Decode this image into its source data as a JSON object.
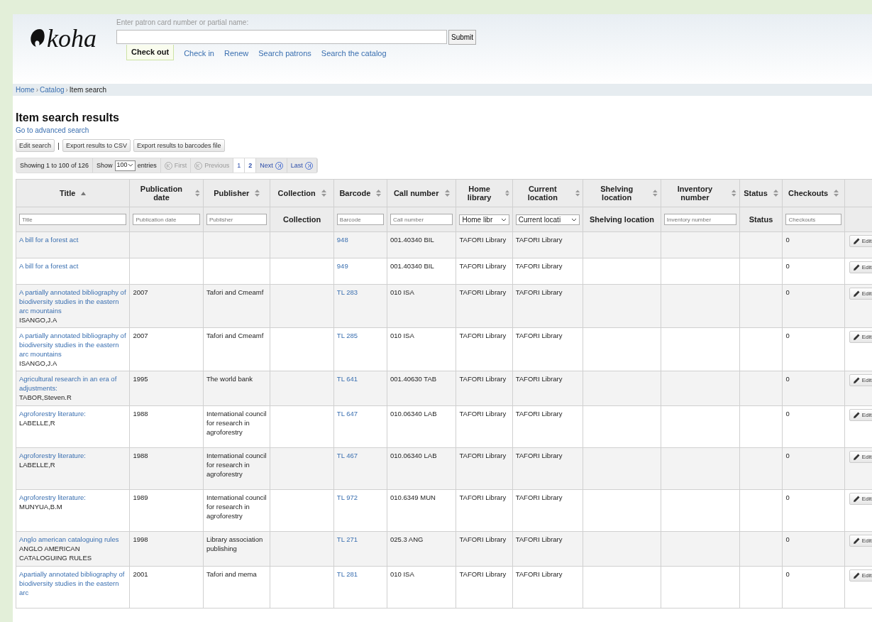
{
  "header": {
    "logo": "koha",
    "search_label": "Enter patron card number or partial name:",
    "submit": "Submit",
    "tabs": [
      {
        "label": "Check out",
        "selected": true
      },
      {
        "label": "Check in",
        "selected": false
      },
      {
        "label": "Renew",
        "selected": false
      },
      {
        "label": "Search patrons",
        "selected": false
      },
      {
        "label": "Search the catalog",
        "selected": false
      }
    ]
  },
  "breadcrumbs": [
    {
      "label": "Home",
      "link": true
    },
    {
      "label": "Catalog",
      "link": true
    },
    {
      "label": "Item search",
      "link": false
    }
  ],
  "breadcrumb_separator": "›",
  "page_title": "Item search results",
  "advanced_link": "Go to advanced search",
  "toolbar": {
    "buttons": [
      "Edit search",
      "Export results to CSV",
      "Export results to barcodes file"
    ],
    "separator": "|"
  },
  "pagination": {
    "info": "Showing 1 to 100 of 126",
    "show_label": "Show",
    "page_size": "100",
    "entries_label": "entries",
    "controls": [
      {
        "kind": "nav",
        "label": "First",
        "disabled": true
      },
      {
        "kind": "nav",
        "label": "Previous",
        "disabled": true
      },
      {
        "kind": "page",
        "label": "1",
        "selected": true
      },
      {
        "kind": "page",
        "label": "2",
        "selected": false
      },
      {
        "kind": "nav",
        "label": "Next",
        "disabled": false
      },
      {
        "kind": "nav",
        "label": "Last",
        "disabled": false
      }
    ]
  },
  "table": {
    "columns": [
      {
        "label": "Title",
        "sorted": true,
        "filter": {
          "kind": "input",
          "placeholder": "Title"
        }
      },
      {
        "label": "Publication date",
        "sorted": false,
        "filter": {
          "kind": "input",
          "placeholder": "Publication date"
        }
      },
      {
        "label": "Publisher",
        "sorted": false,
        "filter": {
          "kind": "input",
          "placeholder": "Publisher"
        }
      },
      {
        "label": "Collection",
        "sorted": false,
        "filter": {
          "kind": "label",
          "text": "Collection"
        }
      },
      {
        "label": "Barcode",
        "sorted": false,
        "filter": {
          "kind": "input",
          "placeholder": "Barcode"
        }
      },
      {
        "label": "Call number",
        "sorted": false,
        "filter": {
          "kind": "input",
          "placeholder": "Call number"
        }
      },
      {
        "label": "Home library",
        "sorted": false,
        "filter": {
          "kind": "select",
          "value": "Home libr"
        }
      },
      {
        "label": "Current location",
        "sorted": false,
        "filter": {
          "kind": "select",
          "value": "Current locati"
        }
      },
      {
        "label": "Shelving location",
        "sorted": false,
        "filter": {
          "kind": "label",
          "text": "Shelving location"
        }
      },
      {
        "label": "Inventory number",
        "sorted": false,
        "filter": {
          "kind": "input",
          "placeholder": "Inventory number"
        }
      },
      {
        "label": "Status",
        "sorted": false,
        "filter": {
          "kind": "label",
          "text": "Status"
        }
      },
      {
        "label": "Checkouts",
        "sorted": false,
        "filter": {
          "kind": "input",
          "placeholder": "Checkouts"
        }
      }
    ],
    "rows": [
      {
        "title": "A bill for a forest act",
        "author": "",
        "date": "",
        "publisher": "",
        "collection": "",
        "barcode": "948",
        "call_number": "001.40340 BIL",
        "home": "TAFORI Library",
        "current": "TAFORI Library",
        "shelving": "",
        "inventory": "",
        "status": "",
        "checkouts": "0",
        "action": "Edit"
      },
      {
        "title": "A bill for a forest act",
        "author": "",
        "date": "",
        "publisher": "",
        "collection": "",
        "barcode": "949",
        "call_number": "001.40340 BIL",
        "home": "TAFORI Library",
        "current": "TAFORI Library",
        "shelving": "",
        "inventory": "",
        "status": "",
        "checkouts": "0",
        "action": "Edit"
      },
      {
        "title": "A partially annotated bibliography of biodiversity studies in the eastern arc mountains",
        "author": "ISANGO,J.A",
        "date": "2007",
        "publisher": "Tafori and Cmeamf",
        "collection": "",
        "barcode": "TL 283",
        "call_number": "010 ISA",
        "home": "TAFORI Library",
        "current": "TAFORI Library",
        "shelving": "",
        "inventory": "",
        "status": "",
        "checkouts": "0",
        "action": "Edit"
      },
      {
        "title": "A partially annotated bibliography of biodiversity studies in the eastern arc mountains",
        "author": "ISANGO,J.A",
        "date": "2007",
        "publisher": "Tafori and Cmeamf",
        "collection": "",
        "barcode": "TL 285",
        "call_number": "010 ISA",
        "home": "TAFORI Library",
        "current": "TAFORI Library",
        "shelving": "",
        "inventory": "",
        "status": "",
        "checkouts": "0",
        "action": "Edit"
      },
      {
        "title": "Agricultural research in an era of adjustments:",
        "author": "TABOR,Steven.R",
        "date": "1995",
        "publisher": "The world bank",
        "collection": "",
        "barcode": "TL 641",
        "call_number": "001.40630 TAB",
        "home": "TAFORI Library",
        "current": "TAFORI Library",
        "shelving": "",
        "inventory": "",
        "status": "",
        "checkouts": "0",
        "action": "Edit"
      },
      {
        "title": "Agroforestry literature:",
        "author": "LABELLE,R",
        "date": "1988",
        "publisher": "International council for research in agroforestry",
        "collection": "",
        "barcode": "TL 647",
        "call_number": "010.06340 LAB",
        "home": "TAFORI Library",
        "current": "TAFORI Library",
        "shelving": "",
        "inventory": "",
        "status": "",
        "checkouts": "0",
        "action": "Edit"
      },
      {
        "title": "Agroforestry literature:",
        "author": "LABELLE,R",
        "date": "1988",
        "publisher": "International council for research in agroforestry",
        "collection": "",
        "barcode": "TL 467",
        "call_number": "010.06340 LAB",
        "home": "TAFORI Library",
        "current": "TAFORI Library",
        "shelving": "",
        "inventory": "",
        "status": "",
        "checkouts": "0",
        "action": "Edit"
      },
      {
        "title": "Agroforestry literature:",
        "author": "MUNYUA,B.M",
        "date": "1989",
        "publisher": "International council for research in agroforestry",
        "collection": "",
        "barcode": "TL 972",
        "call_number": "010.6349 MUN",
        "home": "TAFORI Library",
        "current": "TAFORI Library",
        "shelving": "",
        "inventory": "",
        "status": "",
        "checkouts": "0",
        "action": "Edit"
      },
      {
        "title": "Anglo american cataloguing rules",
        "author": "ANGLO AMERICAN CATALOGUING RULES",
        "date": "1998",
        "publisher": "Library association publishing",
        "collection": "",
        "barcode": "TL 271",
        "call_number": "025.3 ANG",
        "home": "TAFORI Library",
        "current": "TAFORI Library",
        "shelving": "",
        "inventory": "",
        "status": "",
        "checkouts": "0",
        "action": "Edit"
      },
      {
        "title": "Apartially annotated bibliography of biodiversity studies in the eastern arc",
        "author": "",
        "date": "2001",
        "publisher": "Tafori and mema",
        "collection": "",
        "barcode": "TL 281",
        "call_number": "010 ISA",
        "home": "TAFORI Library",
        "current": "TAFORI Library",
        "shelving": "",
        "inventory": "",
        "status": "",
        "checkouts": "0",
        "action": "Edit"
      }
    ]
  }
}
